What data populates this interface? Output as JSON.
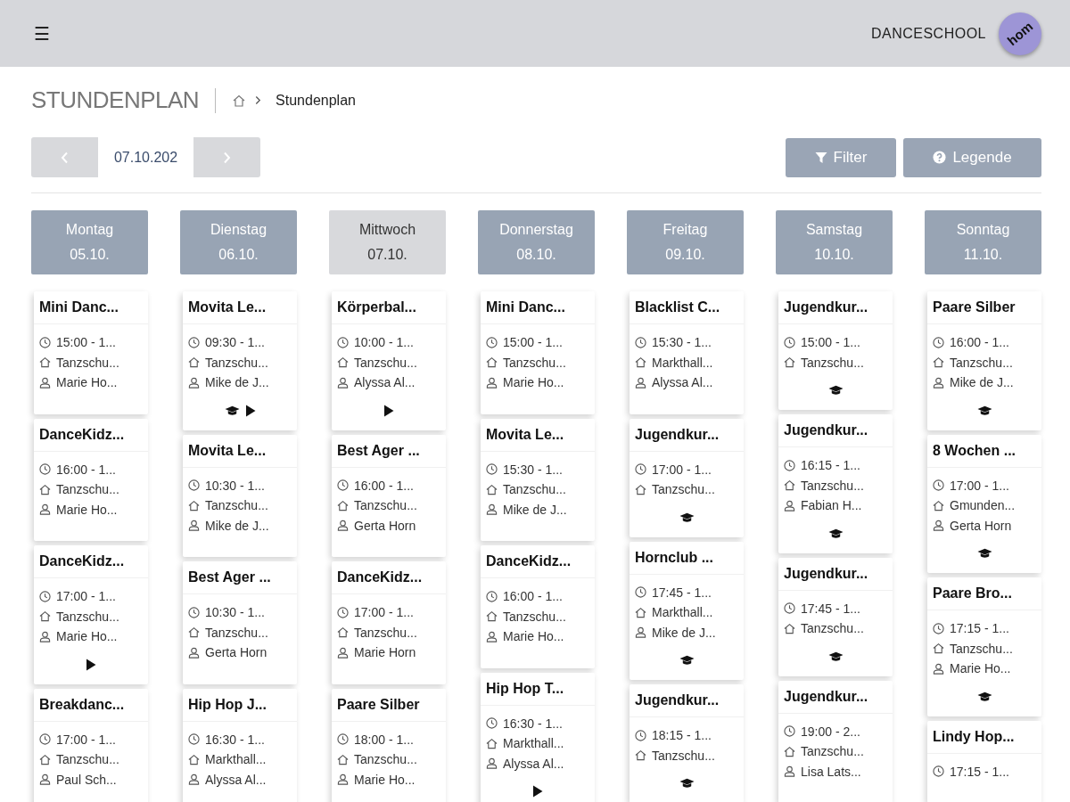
{
  "topbar": {
    "menu_icon": "☰",
    "brand": "DANCESCHOOL",
    "avatar": "hom"
  },
  "page": {
    "title": "STUNDENPLAN",
    "breadcrumb": "Stundenplan"
  },
  "date_nav": {
    "value": "07.10.202"
  },
  "actions": [
    {
      "kind": "filter",
      "label": "Filter"
    },
    {
      "kind": "help",
      "label": "Legende"
    }
  ],
  "days": [
    {
      "name": "Montag",
      "date": "05.10.",
      "selected": false,
      "lessons": [
        {
          "title": "Mini Danc...",
          "time": "15:00 - 1...",
          "place": "Tanzschu...",
          "teacher": "Marie Ho..."
        },
        {
          "title": "DanceKidz...",
          "time": "16:00 - 1...",
          "place": "Tanzschu...",
          "teacher": "Marie Ho..."
        },
        {
          "title": "DanceKidz...",
          "time": "17:00 - 1...",
          "place": "Tanzschu...",
          "teacher": "Marie Ho...",
          "icons": [
            {
              "kind": "play"
            }
          ]
        },
        {
          "title": "Breakdanc...",
          "time": "17:00 - 1...",
          "place": "Tanzschu...",
          "teacher": "Paul Sch..."
        }
      ]
    },
    {
      "name": "Dienstag",
      "date": "06.10.",
      "selected": false,
      "lessons": [
        {
          "title": "Movita Le...",
          "time": "09:30 - 1...",
          "place": "Tanzschu...",
          "teacher": "Mike de J...",
          "icons": [
            {
              "kind": "cap"
            },
            {
              "kind": "play"
            }
          ]
        },
        {
          "title": "Movita Le...",
          "time": "10:30 - 1...",
          "place": "Tanzschu...",
          "teacher": "Mike de J..."
        },
        {
          "title": "Best Ager ...",
          "time": "10:30 - 1...",
          "place": "Tanzschu...",
          "teacher": "Gerta Horn"
        },
        {
          "title": "Hip Hop J...",
          "time": "16:30 - 1...",
          "place": "Markthall...",
          "teacher": "Alyssa Al..."
        }
      ]
    },
    {
      "name": "Mittwoch",
      "date": "07.10.",
      "selected": true,
      "lessons": [
        {
          "title": "Körperbal...",
          "time": "10:00 - 1...",
          "place": "Tanzschu...",
          "teacher": "Alyssa Al...",
          "icons": [
            {
              "kind": "play"
            }
          ]
        },
        {
          "title": "Best Ager ...",
          "time": "16:00 - 1...",
          "place": "Tanzschu...",
          "teacher": "Gerta Horn"
        },
        {
          "title": "DanceKidz...",
          "time": "17:00 - 1...",
          "place": "Tanzschu...",
          "teacher": "Marie Horn"
        },
        {
          "title": "Paare Silber",
          "time": "18:00 - 1...",
          "place": "Tanzschu...",
          "teacher": "Marie Ho..."
        }
      ]
    },
    {
      "name": "Donnerstag",
      "date": "08.10.",
      "selected": false,
      "lessons": [
        {
          "title": "Mini Danc...",
          "time": "15:00 - 1...",
          "place": "Tanzschu...",
          "teacher": "Marie Ho..."
        },
        {
          "title": "Movita Le...",
          "time": "15:30 - 1...",
          "place": "Tanzschu...",
          "teacher": "Mike de J..."
        },
        {
          "title": "DanceKidz...",
          "time": "16:00 - 1...",
          "place": "Tanzschu...",
          "teacher": "Marie Ho..."
        },
        {
          "title": "Hip Hop T...",
          "time": "16:30 - 1...",
          "place": "Markthall...",
          "teacher": "Alyssa Al...",
          "icons": [
            {
              "kind": "play"
            }
          ]
        }
      ]
    },
    {
      "name": "Freitag",
      "date": "09.10.",
      "selected": false,
      "lessons": [
        {
          "title": "Blacklist C...",
          "time": "15:30 - 1...",
          "place": "Markthall...",
          "teacher": "Alyssa Al..."
        },
        {
          "title": "Jugendkur...",
          "time": "17:00 - 1...",
          "place": "Tanzschu...",
          "icons": [
            {
              "kind": "cap"
            }
          ]
        },
        {
          "title": "Hornclub ...",
          "time": "17:45 - 1...",
          "place": "Markthall...",
          "teacher": "Mike de J...",
          "icons": [
            {
              "kind": "cap"
            }
          ]
        },
        {
          "title": "Jugendkur...",
          "time": "18:15 - 1...",
          "place": "Tanzschu...",
          "icons": [
            {
              "kind": "cap"
            }
          ]
        }
      ]
    },
    {
      "name": "Samstag",
      "date": "10.10.",
      "selected": false,
      "lessons": [
        {
          "title": "Jugendkur...",
          "time": "15:00 - 1...",
          "place": "Tanzschu...",
          "icons": [
            {
              "kind": "cap"
            }
          ]
        },
        {
          "title": "Jugendkur...",
          "time": "16:15 - 1...",
          "place": "Tanzschu...",
          "teacher": "Fabian H...",
          "icons": [
            {
              "kind": "cap"
            }
          ]
        },
        {
          "title": "Jugendkur...",
          "time": "17:45 - 1...",
          "place": "Tanzschu...",
          "icons": [
            {
              "kind": "cap"
            }
          ]
        },
        {
          "title": "Jugendkur...",
          "time": "19:00 - 2...",
          "place": "Tanzschu...",
          "teacher": "Lisa Lats..."
        }
      ]
    },
    {
      "name": "Sonntag",
      "date": "11.10.",
      "selected": false,
      "lessons": [
        {
          "title": "Paare Silber",
          "time": "16:00 - 1...",
          "place": "Tanzschu...",
          "teacher": "Mike de J...",
          "icons": [
            {
              "kind": "cap"
            }
          ]
        },
        {
          "title": "8 Wochen ...",
          "time": "17:00 - 1...",
          "place": "Gmunden...",
          "teacher": "Gerta Horn",
          "icons": [
            {
              "kind": "cap"
            }
          ]
        },
        {
          "title": "Paare Bro...",
          "time": "17:15 - 1...",
          "place": "Tanzschu...",
          "teacher": "Marie Ho...",
          "icons": [
            {
              "kind": "cap"
            }
          ]
        },
        {
          "title": "Lindy Hop...",
          "time": "17:15 - 1..."
        }
      ]
    }
  ]
}
